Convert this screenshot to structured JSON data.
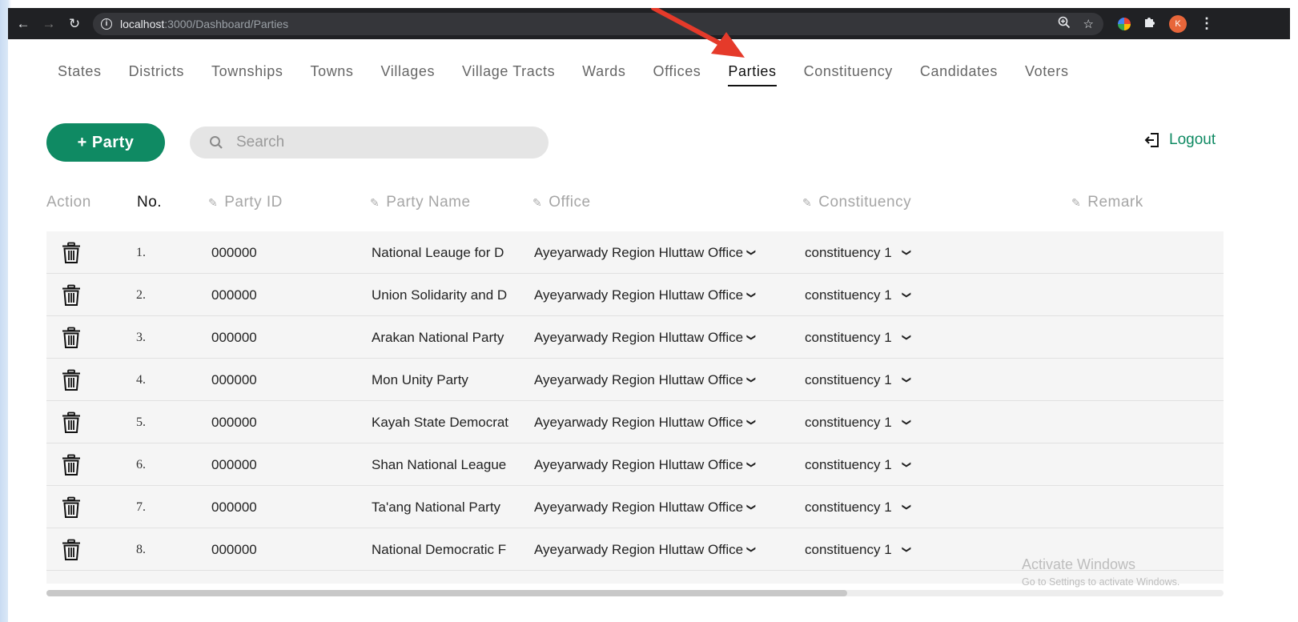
{
  "browser": {
    "url_host": "localhost",
    "url_path": ":3000/Dashboard/Parties",
    "avatar_letter": "K"
  },
  "nav": {
    "tabs": [
      "States",
      "Districts",
      "Townships",
      "Towns",
      "Villages",
      "Village Tracts",
      "Wards",
      "Offices",
      "Parties",
      "Constituency",
      "Candidates",
      "Voters"
    ],
    "active": "Parties"
  },
  "toolbar": {
    "add_label": "+ Party",
    "search_placeholder": "Search",
    "logout_label": "Logout"
  },
  "table": {
    "headers": {
      "action": "Action",
      "no": "No.",
      "party_id": "Party ID",
      "party_name": "Party Name",
      "office": "Office",
      "constituency": "Constituency",
      "remark": "Remark"
    },
    "rows": [
      {
        "no": "1.",
        "party_id": "000000",
        "party_name": "National Leauge for D",
        "office": "Ayeyarwady Region Hluttaw Office",
        "constituency": "constituency 1"
      },
      {
        "no": "2.",
        "party_id": "000000",
        "party_name": "Union Solidarity and D",
        "office": "Ayeyarwady Region Hluttaw Office",
        "constituency": "constituency 1"
      },
      {
        "no": "3.",
        "party_id": "000000",
        "party_name": "Arakan National Party",
        "office": "Ayeyarwady Region Hluttaw Office",
        "constituency": "constituency 1"
      },
      {
        "no": "4.",
        "party_id": "000000",
        "party_name": "Mon Unity Party",
        "office": "Ayeyarwady Region Hluttaw Office",
        "constituency": "constituency 1"
      },
      {
        "no": "5.",
        "party_id": "000000",
        "party_name": "Kayah State Democrat",
        "office": "Ayeyarwady Region Hluttaw Office",
        "constituency": "constituency 1"
      },
      {
        "no": "6.",
        "party_id": "000000",
        "party_name": "Shan National League",
        "office": "Ayeyarwady Region Hluttaw Office",
        "constituency": "constituency 1"
      },
      {
        "no": "7.",
        "party_id": "000000",
        "party_name": "Ta'ang National Party",
        "office": "Ayeyarwady Region Hluttaw Office",
        "constituency": "constituency 1"
      },
      {
        "no": "8.",
        "party_id": "000000",
        "party_name": "National Democratic F",
        "office": "Ayeyarwady Region Hluttaw Office",
        "constituency": "constituency 1"
      }
    ],
    "horizontal_scroll_fraction": 0.68
  },
  "watermark": {
    "title": "Activate Windows",
    "subtitle": "Go to Settings to activate Windows."
  },
  "colors": {
    "accent": "#0f8a63",
    "annotation_arrow": "#e53a2a"
  }
}
